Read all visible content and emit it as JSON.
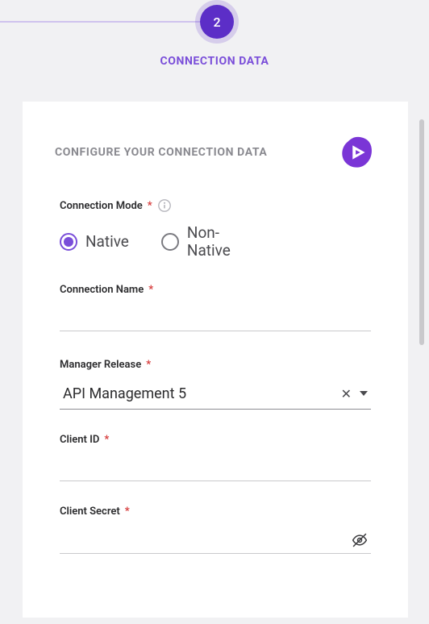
{
  "stepper": {
    "number": "2",
    "title": "CONNECTION DATA"
  },
  "card": {
    "title": "CONFIGURE YOUR CONNECTION DATA"
  },
  "fields": {
    "mode": {
      "label": "Connection Mode",
      "required": "*",
      "options": {
        "native": "Native",
        "nonnative": "Non-Native"
      }
    },
    "name": {
      "label": "Connection Name",
      "required": "*",
      "value": ""
    },
    "release": {
      "label": "Manager Release",
      "required": "*",
      "value": "API Management 5"
    },
    "clientId": {
      "label": "Client ID",
      "required": "*",
      "value": ""
    },
    "clientSecret": {
      "label": "Client Secret",
      "required": "*",
      "value": ""
    }
  }
}
